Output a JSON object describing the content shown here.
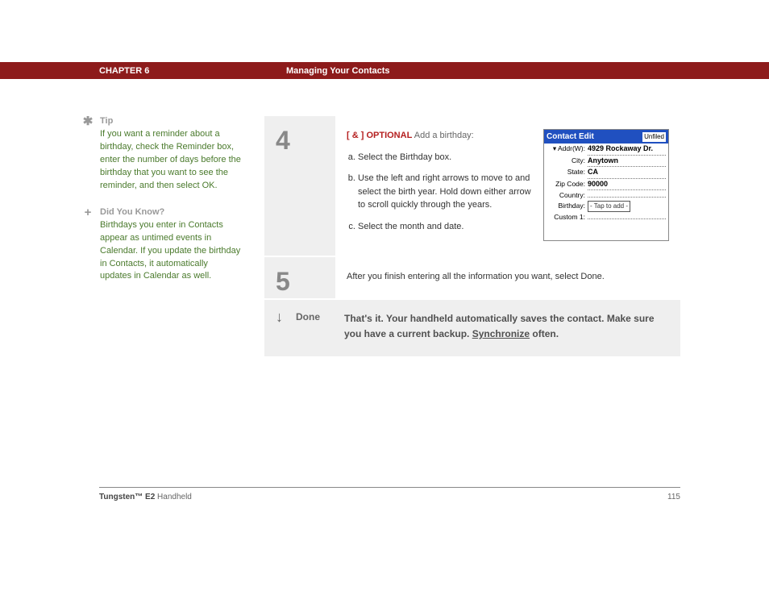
{
  "header": {
    "chapter": "CHAPTER 6",
    "title": "Managing Your Contacts"
  },
  "sidebar": {
    "tip": {
      "icon": "✱",
      "heading": "Tip",
      "body": "If you want a reminder about a birthday, check the Reminder box, enter the number of days before the birthday that you want to see the reminder, and then select OK."
    },
    "dyk": {
      "icon": "+",
      "heading": "Did You Know?",
      "body": "Birthdays you enter in Contacts appear as untimed events in Calendar. If you update the birthday in Contacts, it automatically updates in Calendar as well."
    }
  },
  "steps": {
    "s4": {
      "num": "4",
      "tag1": "[ & ]",
      "tag2": "OPTIONAL",
      "lead": "Add a birthday:",
      "a": "Select the Birthday box.",
      "b": "Use the left and right arrows to move to and select the birth year. Hold down either arrow to scroll quickly through the years.",
      "c": "Select the month and date."
    },
    "s5": {
      "num": "5",
      "body": "After you finish entering all the information you want, select Done."
    }
  },
  "screenshot": {
    "title": "Contact Edit",
    "category": "Unfiled",
    "rows": {
      "addr_label": "Addr(W):",
      "addr_val": "4929 Rockaway Dr.",
      "city_label": "City:",
      "city_val": "Anytown",
      "state_label": "State:",
      "state_val": "CA",
      "zip_label": "Zip Code:",
      "zip_val": "90000",
      "country_label": "Country:",
      "country_val": "",
      "bday_label": "Birthday:",
      "bday_val": "- Tap to add -",
      "custom_label": "Custom 1:",
      "custom_val": ""
    }
  },
  "done": {
    "icon": "↓",
    "label": "Done",
    "text1": "That's it. Your handheld automatically saves the contact. Make sure you have a current backup. ",
    "link": "Synchronize",
    "text2": " often."
  },
  "footer": {
    "product_bold": "Tungsten™ E2",
    "product_rest": " Handheld",
    "page": "115"
  }
}
